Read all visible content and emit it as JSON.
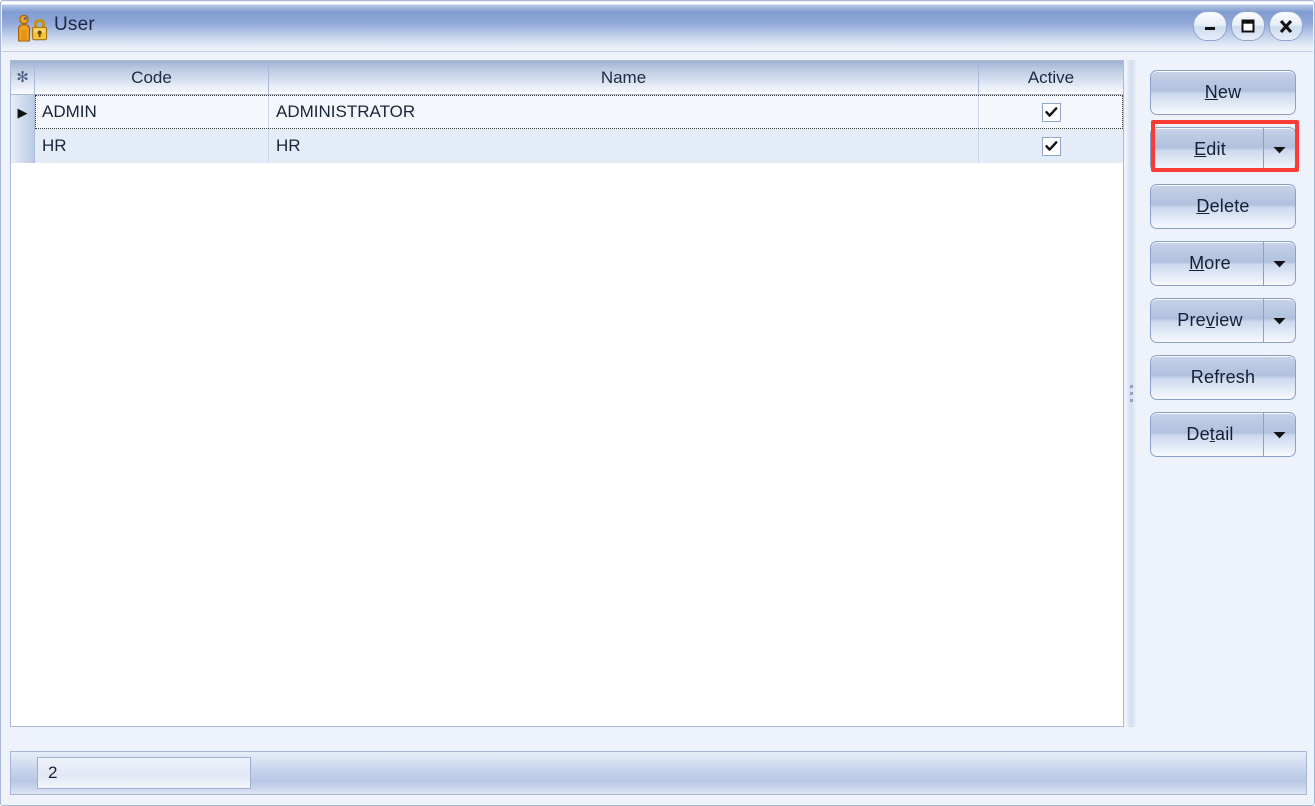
{
  "window": {
    "title": "User",
    "icon": "user-lock-icon",
    "controls": [
      {
        "name": "minimize",
        "glyph": "minimize-icon"
      },
      {
        "name": "maximize",
        "glyph": "maximize-icon"
      },
      {
        "name": "close",
        "glyph": "close-icon"
      }
    ]
  },
  "grid": {
    "indicator_header_glyph": "✻",
    "columns": [
      {
        "key": "code",
        "label": "Code"
      },
      {
        "key": "name",
        "label": "Name"
      },
      {
        "key": "active",
        "label": "Active"
      }
    ],
    "rows": [
      {
        "indicator": "▶",
        "code": "ADMIN",
        "name": "ADMINISTRATOR",
        "active": true,
        "selected": true
      },
      {
        "indicator": "",
        "code": "HR",
        "name": "HR",
        "active": true,
        "selected": false
      }
    ]
  },
  "buttons": [
    {
      "name": "new",
      "label": "New",
      "mnemonic": "N",
      "has_dropdown": false,
      "highlighted": false
    },
    {
      "name": "edit",
      "label": "Edit",
      "mnemonic": "E",
      "has_dropdown": true,
      "highlighted": true
    },
    {
      "name": "delete",
      "label": "Delete",
      "mnemonic": "D",
      "has_dropdown": false,
      "highlighted": false
    },
    {
      "name": "more",
      "label": "More",
      "mnemonic": "M",
      "has_dropdown": true,
      "highlighted": false
    },
    {
      "name": "preview",
      "label": "Preview",
      "mnemonic": "v",
      "has_dropdown": true,
      "highlighted": false
    },
    {
      "name": "refresh",
      "label": "Refresh",
      "mnemonic": "",
      "has_dropdown": false,
      "highlighted": false
    },
    {
      "name": "detail",
      "label": "Detail",
      "mnemonic": "t",
      "has_dropdown": true,
      "highlighted": false
    }
  ],
  "statusbar": {
    "record_count": "2"
  },
  "colors": {
    "titlebar_blue": "#7f9bd0",
    "header_blue": "#9fb2d4",
    "row_alt": "#e4edf7",
    "highlight_red": "#fb3b35",
    "border": "#aab9d8"
  }
}
